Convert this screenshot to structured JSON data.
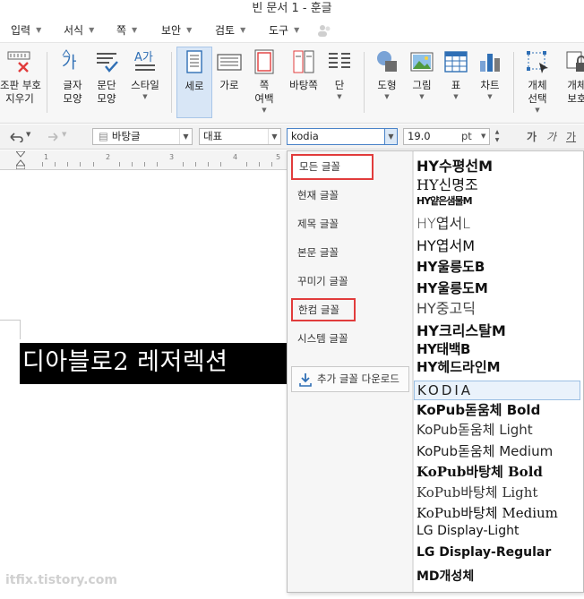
{
  "window": {
    "title": "빈 문서 1 - 훈글"
  },
  "menu": {
    "items": [
      {
        "label": "입력"
      },
      {
        "label": "서식"
      },
      {
        "label": "쪽"
      },
      {
        "label": "보안"
      },
      {
        "label": "검토"
      },
      {
        "label": "도구"
      }
    ]
  },
  "ribbon": {
    "buttons": [
      {
        "label": "조판 부호",
        "label2": "지우기"
      },
      {
        "label": "글자",
        "label2": "모양"
      },
      {
        "label": "문단",
        "label2": "모양"
      },
      {
        "label": "스타일"
      },
      {
        "label": "세로"
      },
      {
        "label": "가로"
      },
      {
        "label": "쪽",
        "label2": "여백"
      },
      {
        "label": "바탕쪽"
      },
      {
        "label": "단"
      },
      {
        "label": "도형"
      },
      {
        "label": "그림"
      },
      {
        "label": "표"
      },
      {
        "label": "차트"
      },
      {
        "label": "개체",
        "label2": "선택"
      },
      {
        "label": "개체",
        "label2": "보호"
      }
    ]
  },
  "format_toolbar": {
    "style": "바탕글",
    "lang": "대표",
    "font": "kodia",
    "size": "19.0",
    "unit": "pt",
    "bold_glyph": "가",
    "italic_glyph": "가",
    "underline_glyph": "가"
  },
  "ruler": {
    "numbers": [
      "1",
      "2",
      "3",
      "4",
      "5"
    ]
  },
  "document": {
    "text": "디아블로2 레저렉션"
  },
  "font_panel": {
    "categories": [
      {
        "label": "모든 글꼴"
      },
      {
        "label": "현재 글꼴"
      },
      {
        "label": "제목 글꼴"
      },
      {
        "label": "본문 글꼴"
      },
      {
        "label": "꾸미기 글꼴"
      },
      {
        "label": "한컴 글꼴"
      },
      {
        "label": "시스템 글꼴"
      }
    ],
    "download_label": "추가 글꼴 다운로드",
    "fonts": [
      {
        "name": "HY수평선M"
      },
      {
        "name": "HY신명조"
      },
      {
        "name": "HY얕은샘물M"
      },
      {
        "name": "HY엽서L"
      },
      {
        "name": "HY엽서M"
      },
      {
        "name": "HY울릉도B"
      },
      {
        "name": "HY울릉도M"
      },
      {
        "name": "HY중고딕"
      },
      {
        "name": "HY크리스탈M"
      },
      {
        "name": "HY태백B"
      },
      {
        "name": "HY헤드라인M"
      },
      {
        "name": "KODIA"
      },
      {
        "name": "KoPub돋움체 Bold"
      },
      {
        "name": "KoPub돋움체 Light"
      },
      {
        "name": "KoPub돋움체 Medium"
      },
      {
        "name": "KoPub바탕체 Bold"
      },
      {
        "name": "KoPub바탕체 Light"
      },
      {
        "name": "KoPub바탕체 Medium"
      },
      {
        "name": "LG Display-Light"
      },
      {
        "name": "LG Display-Regular"
      },
      {
        "name": "MD개성체"
      }
    ]
  },
  "watermark": "itfix.tistory.com",
  "colors": {
    "highlight_red": "#e13c3c",
    "selection_blue": "#4a83c8",
    "text_block_bg": "#000000"
  }
}
